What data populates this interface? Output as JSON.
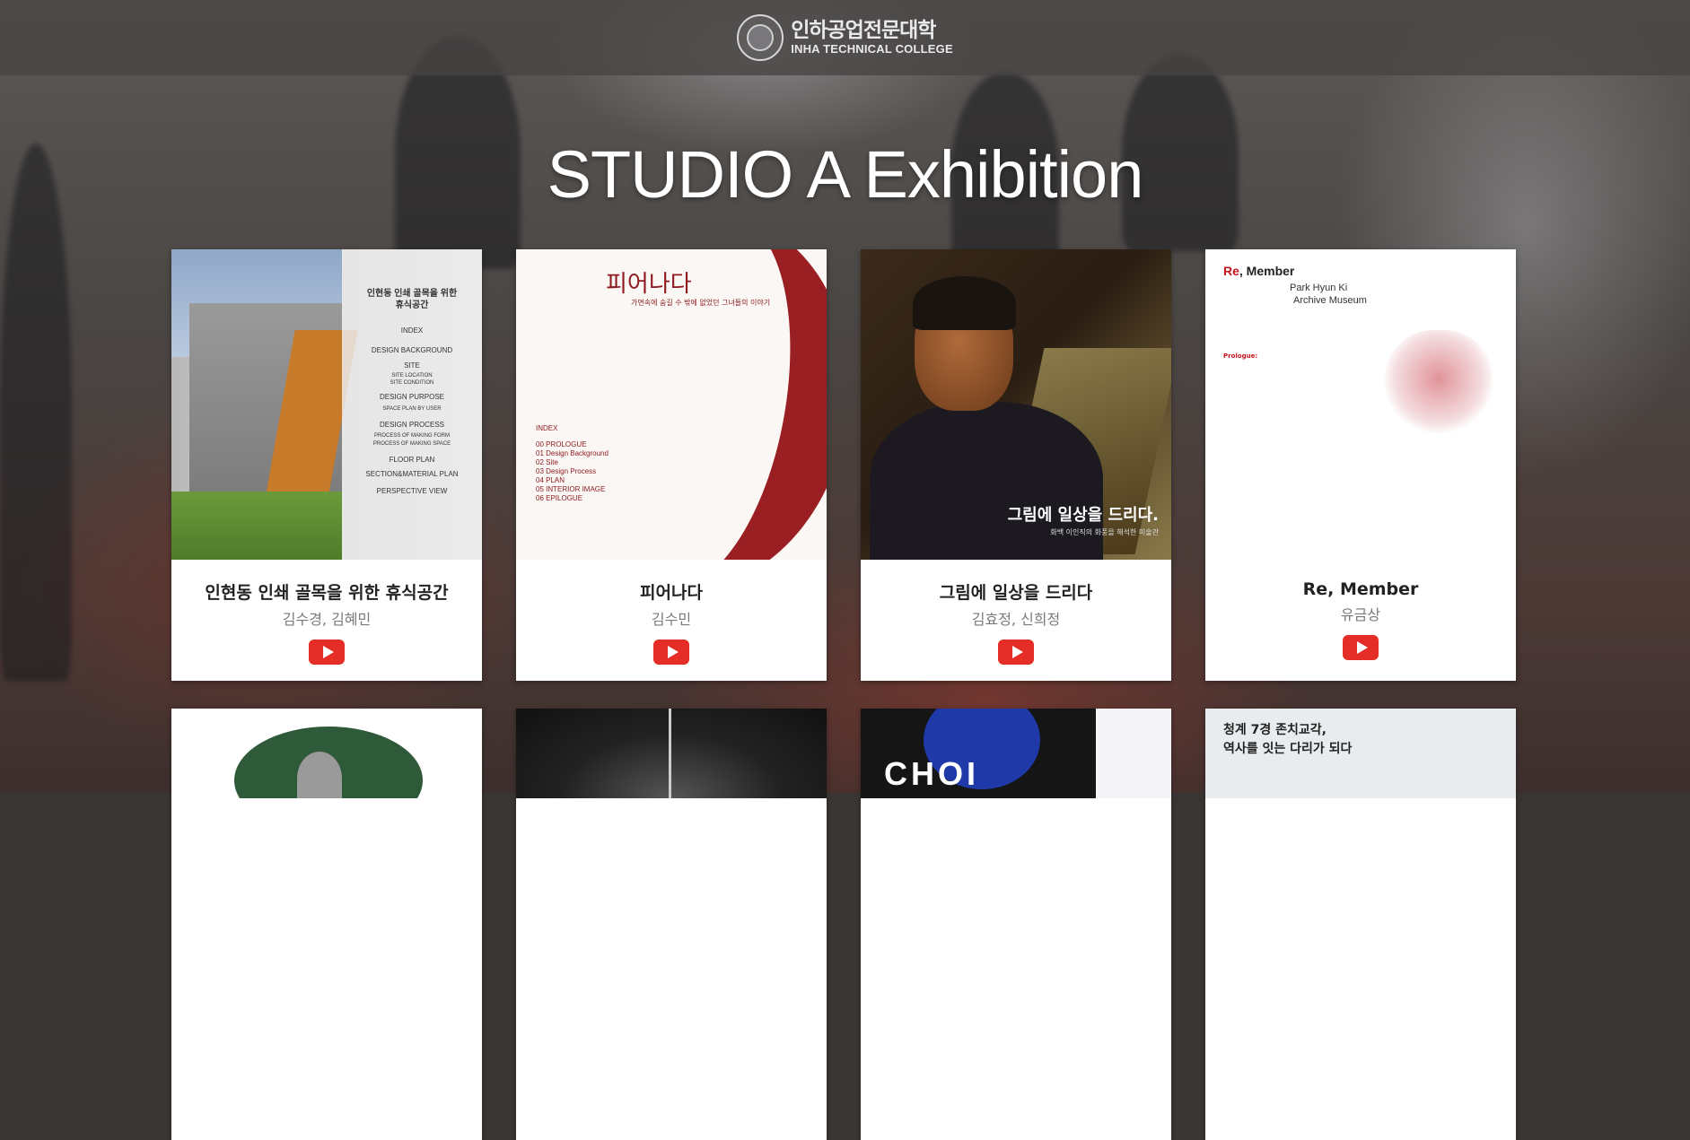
{
  "header": {
    "logo_korean": "인하공업전문대학",
    "logo_english": "INHA TECHNICAL COLLEGE"
  },
  "page_title": "STUDIO A Exhibition",
  "cards": [
    {
      "title": "인현동 인쇄 골목을 위한 휴식공간",
      "authors": "김수경, 김혜민",
      "thumb_lines": [
        "인현동 인쇄 골목을 위한",
        "휴식공간",
        "INDEX",
        "DESIGN BACKGROUND",
        "SITE",
        "SITE LOCATION",
        "SITE CONDITION",
        "DESIGN PURPOSE",
        "SPACE PLAN BY USER",
        "DESIGN PROCESS",
        "PROCESS OF MAKING FORM",
        "PROCESS OF MAKING SPACE",
        "FLOOR PLAN",
        "SECTION&MATERIAL PLAN",
        "PERSPECTIVE VIEW"
      ]
    },
    {
      "title": "피어나다",
      "authors": "김수민",
      "thumb_heading": "피어나다",
      "thumb_sub": "가면속에 숨길 수 밖에 없었던 그녀들의 이야기",
      "thumb_index": [
        "INDEX",
        "00 PROLOGUE",
        "01 Design Background",
        "02 Site",
        "03 Design Process",
        "04 PLAN",
        "05 INTERIOR IMAGE",
        "06 EPILOGUE"
      ]
    },
    {
      "title": "그림에 일상을 드리다",
      "authors": "김효정, 신희정",
      "thumb_caption": "그림에 일상을 드리다.",
      "thumb_sub": "화백 이인직의 화풍을 해석한 미술관"
    },
    {
      "title": "Re, Member",
      "authors": "유금상",
      "thumb_re": "Re",
      "thumb_member": ", Member",
      "thumb_lines": [
        "Park Hyun Ki",
        "Archive Museum"
      ],
      "thumb_prologue": "Prologue:"
    }
  ],
  "cards_row2": [
    {
      "thumb_text": ""
    },
    {
      "thumb_text": ""
    },
    {
      "thumb_text": "CHOI"
    },
    {
      "thumb_text": "청계 7경 존치교각,\n역사를 잇는 다리가 되다"
    }
  ],
  "colors": {
    "youtube_red": "#e52d27",
    "ribbon_red": "#9a1f23",
    "header_overlay": "#464443"
  },
  "icons": [
    "youtube-play-icon"
  ]
}
